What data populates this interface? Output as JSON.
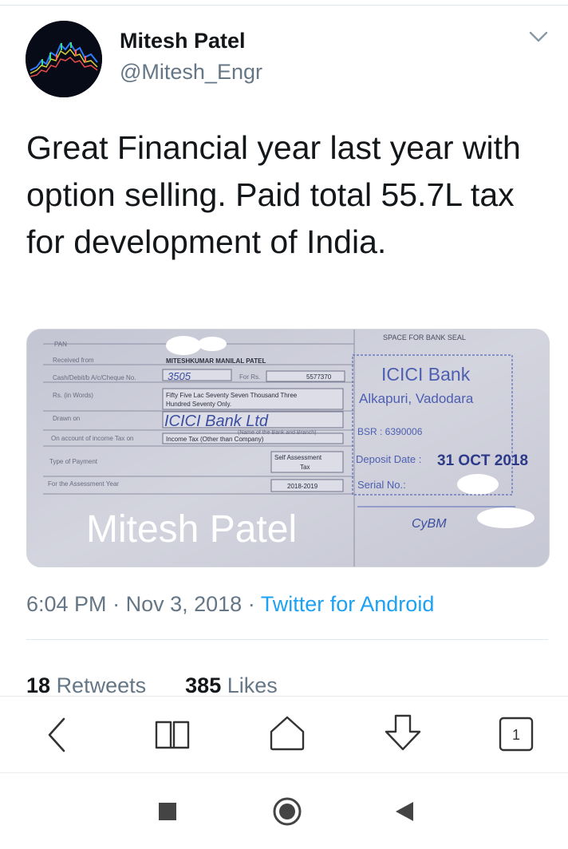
{
  "tweet": {
    "author_name": "Mitesh Patel",
    "author_handle": "@Mitesh_Engr",
    "text": "Great Financial year last year with option selling. Paid total 55.7L tax for development of India.",
    "time": "6:04 PM",
    "date": "Nov 3, 2018",
    "separator": "·",
    "source": "Twitter for Android",
    "retweets_count": "18",
    "retweets_label": "Retweets",
    "likes_count": "385",
    "likes_label": "Likes"
  },
  "media": {
    "pan_label": "PAN",
    "received_from_label": "Received from",
    "received_from_value": "MITESHKUMAR MANILAL PATEL",
    "account_label": "Cash/Debit/b A/c/Cheque No.",
    "account_value": "3505",
    "for_rs_label": "For Rs.",
    "amount": "5577370",
    "rs_words_label": "Rs. (in Words)",
    "rs_words_line1": "Fifty Five Lac Seventy Seven Thousand Three",
    "rs_words_line2": "Hundred Seventy Only.",
    "drawn_on_label": "Drawn on",
    "drawn_on_value": "ICICI Bank Ltd",
    "bank_branch_caption": "(Name of the Bank and Branch)",
    "income_tax_label": "On account of income Tax on",
    "income_tax_value": "Income Tax (Other than Company)",
    "payment_type_label": "Type of Payment",
    "payment_type_line1": "Self Assessment",
    "payment_type_line2": "Tax",
    "assessment_year_label": "For the Assessment Year",
    "assessment_year_value": "2018-2019",
    "seal_header": "SPACE FOR BANK SEAL",
    "stamp_bank": "ICICI Bank",
    "stamp_branch": "Alkapuri, Vadodara",
    "stamp_bsr": "BSR : 6390006",
    "stamp_deposit_label": "Deposit Date :",
    "stamp_deposit_value": "31 OCT 2018",
    "stamp_serial": "Serial No.:",
    "watermark": "Mitesh Patel"
  },
  "browser": {
    "tab_count": "1"
  },
  "icons": {
    "caret": "chevron-down-icon",
    "back": "back-arrow-icon",
    "bookmarks": "book-icon",
    "home": "home-icon",
    "download": "download-arrow-icon",
    "tabs": "tabs-icon",
    "nav_recents": "square-icon",
    "nav_home": "circle-icon",
    "nav_back": "triangle-back-icon"
  },
  "colors": {
    "link": "#1da1f2",
    "secondary_text": "#657786",
    "primary_text": "#14171a",
    "stamp_blue": "#3b4ea0"
  }
}
